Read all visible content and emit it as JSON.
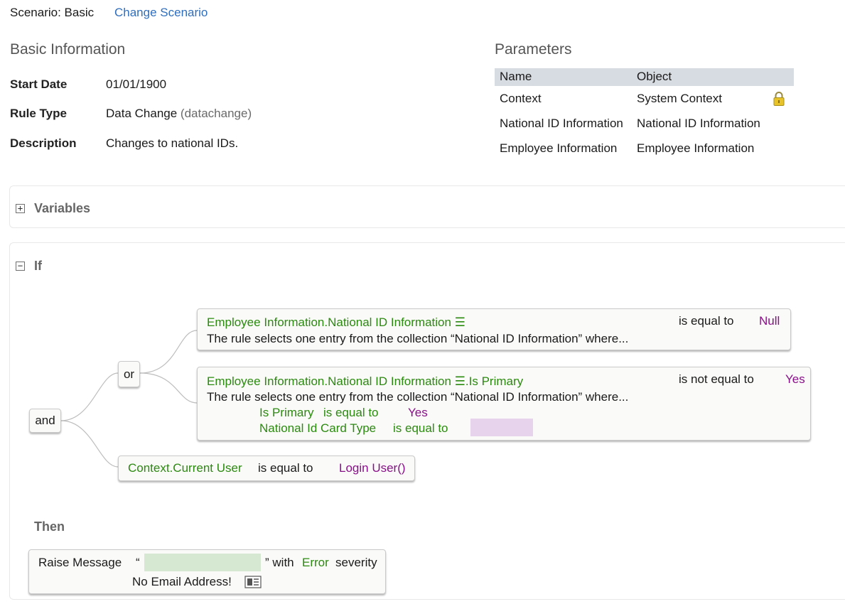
{
  "header": {
    "scenario_label": "Scenario: Basic",
    "change_scenario": "Change Scenario"
  },
  "basic_info": {
    "title": "Basic Information",
    "fields": [
      {
        "label": "Start Date",
        "value": "01/01/1900"
      },
      {
        "label": "Rule Type",
        "value": "Data Change",
        "value_extra": "(datachange)"
      },
      {
        "label": "Description",
        "value": "Changes to national IDs."
      }
    ]
  },
  "parameters": {
    "title": "Parameters",
    "columns": [
      "Name",
      "Object"
    ],
    "rows": [
      {
        "name": "Context",
        "object": "System Context",
        "locked": true
      },
      {
        "name": "National ID Information",
        "object": "National ID Information"
      },
      {
        "name": "Employee Information",
        "object": "Employee Information"
      }
    ]
  },
  "variables": {
    "label": "Variables",
    "toggle": "+"
  },
  "if_section": {
    "label": "If",
    "toggle": "−",
    "and_label": "and",
    "or_label": "or",
    "cond1": {
      "field": "Employee Information.National ID Information ☰",
      "op": "is equal to",
      "value": "Null",
      "desc": "The rule selects one entry from the collection “National ID Information” where..."
    },
    "cond2": {
      "field": "Employee Information.National ID Information ☰.Is Primary",
      "op": "is not equal to",
      "value": "Yes",
      "desc": "The rule selects one entry from the collection “National ID Information” where...",
      "sub1_field": "Is Primary",
      "sub1_op": "is equal to",
      "sub1_value": "Yes",
      "sub2_field": "National Id Card Type",
      "sub2_op": "is equal to"
    },
    "cond3": {
      "field": "Context.Current User",
      "op": "is equal to",
      "value": "Login User()"
    }
  },
  "then_section": {
    "label": "Then",
    "action": "Raise Message",
    "open_quote": "“",
    "close_with": "” with",
    "severity": "Error",
    "severity_suffix": "severity",
    "message": "No Email Address!"
  },
  "colors": {
    "link": "#2f6ebd",
    "field_green": "#2b8a0f",
    "value_purple": "#8a0f8a",
    "table_header": "#d7dbe2"
  },
  "icons": [
    "lock-icon",
    "expand-icon",
    "collapse-icon",
    "message-details-icon"
  ]
}
